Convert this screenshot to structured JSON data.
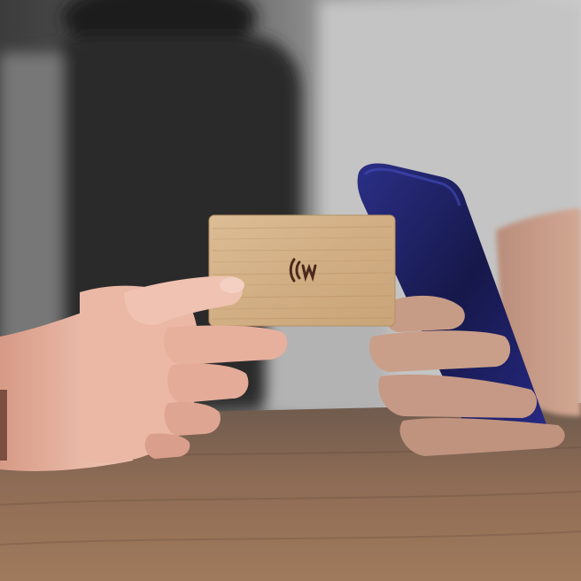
{
  "scene": {
    "description_colors": {
      "background_left": "#4a4a4a",
      "background_right": "#c9c9c9",
      "table_wood": "#8a6a52",
      "card_wood": "#d6b58c",
      "card_grain": "#c7a173",
      "logo_brown": "#4b2a1c",
      "phone_blue": "#1b1f5b",
      "phone_edge": "#2c2f8f",
      "skin_left": "#e8b6a4",
      "skin_right": "#c79a86"
    },
    "card": {
      "logo_icon": "nfc-wave-logo-icon"
    }
  }
}
